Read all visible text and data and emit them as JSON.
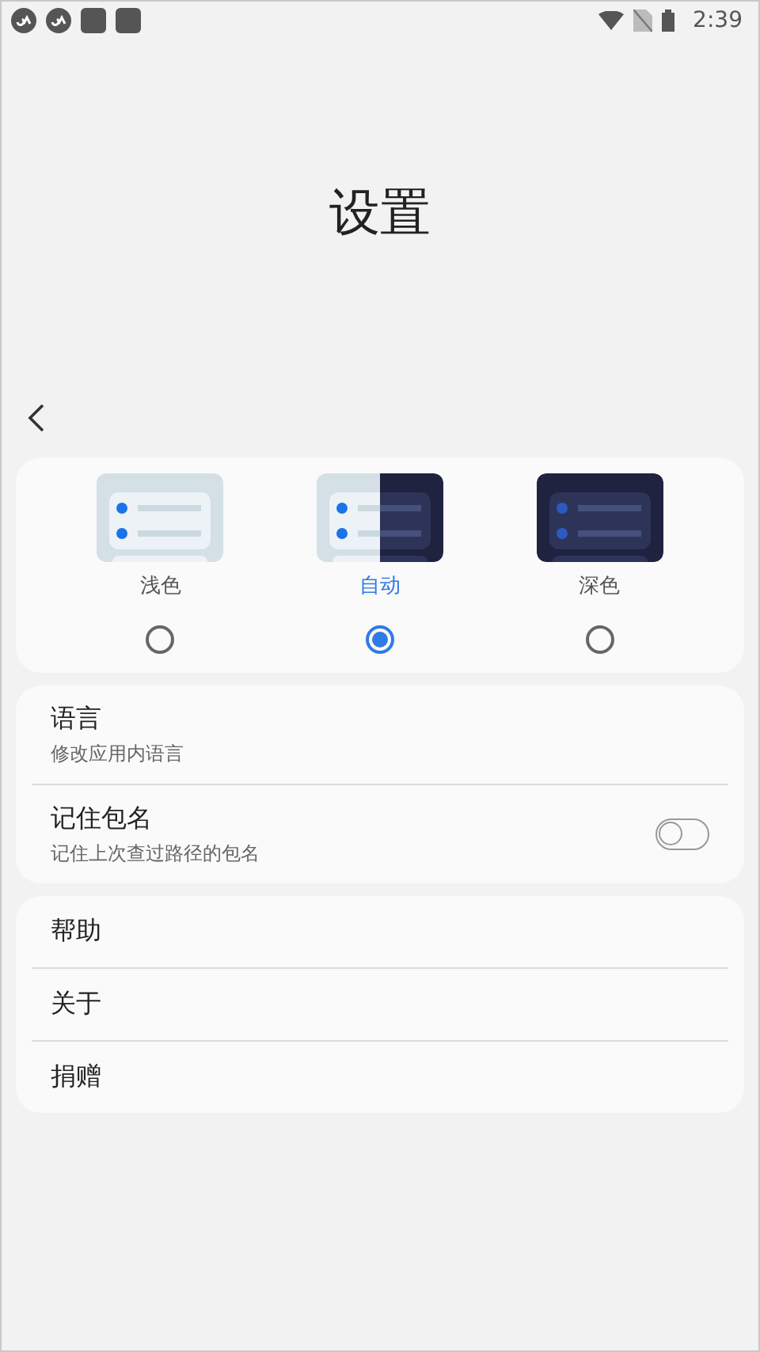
{
  "status_bar": {
    "time": "2:39"
  },
  "title": "设置",
  "themes": [
    {
      "kind": "light",
      "label": "浅色",
      "selected": false
    },
    {
      "kind": "auto",
      "label": "自动",
      "selected": true
    },
    {
      "kind": "dark",
      "label": "深色",
      "selected": false
    }
  ],
  "settings": [
    {
      "title": "语言",
      "subtitle": "修改应用内语言"
    },
    {
      "title": "记住包名",
      "subtitle": "记住上次查过路径的包名",
      "kind": "toggle",
      "on": false
    }
  ],
  "links": [
    {
      "title": "帮助"
    },
    {
      "title": "关于"
    },
    {
      "title": "捐赠"
    }
  ]
}
